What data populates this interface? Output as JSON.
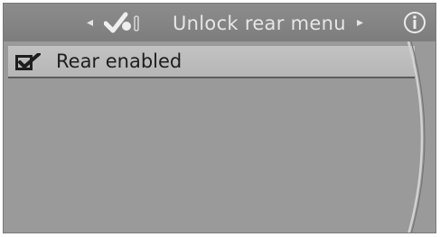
{
  "header": {
    "title": "Unlock rear menu",
    "prev_icon": "chevron-left-icon",
    "next_icon": "chevron-right-icon",
    "app_icon": "checkmark-settings-icon",
    "info_icon": "info-icon"
  },
  "menu": {
    "items": [
      {
        "label": "Rear enabled",
        "checked": true,
        "icon": "checkbox-checked-icon"
      }
    ]
  }
}
